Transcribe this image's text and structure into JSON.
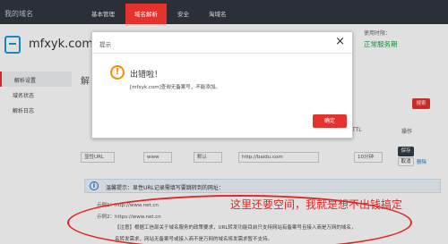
{
  "topbar": {
    "brand": "我的域名",
    "nav": [
      "基本管理",
      "域名解析",
      "安全",
      "淘域名"
    ]
  },
  "domain": {
    "name": "mfxyk.com",
    "status_label": "使用时限：",
    "status_value": "正常服务期"
  },
  "sidebar": {
    "items": [
      "解析设置",
      "域名状态",
      "解析日志"
    ]
  },
  "main": {
    "section_title_partial": "解",
    "search_label": "搜索",
    "th_ttl": "TTL",
    "th_action": "操作",
    "record": {
      "type": "显性URL",
      "host": "www",
      "line": "默认",
      "value": "http://baidu.com",
      "ttl": "10分钟"
    },
    "save_label": "保存",
    "cancel_label": "取消",
    "delete_label": "删除",
    "tip": "温馨提示：显性URL记录需填写要跳转到的网址：",
    "examples": [
      "示例1：http://www.net.cn",
      "示例2：https://www.net.cn"
    ],
    "notice_lines": [
      "【注意】根据工信部关于域名服务的政策要求，URL转发功能目前只支持网站有备案号且接入商是万网的域名，",
      "名转发需求，网站无备案号或接入商不是万网的域名将发需求暂不支持。"
    ]
  },
  "annotation": "这里还要空间，我就是想不出钱搞定",
  "modal": {
    "title": "提示",
    "heading": "出错啦！",
    "message": "[mfxyk.com]查询无备案号，不能添加。",
    "confirm": "确定"
  },
  "colors": {
    "accent": "#e6322e",
    "topbar": "#2b3036",
    "success": "#1aa34a",
    "warning": "#ff8a00",
    "annotation": "#ff2d2d"
  }
}
